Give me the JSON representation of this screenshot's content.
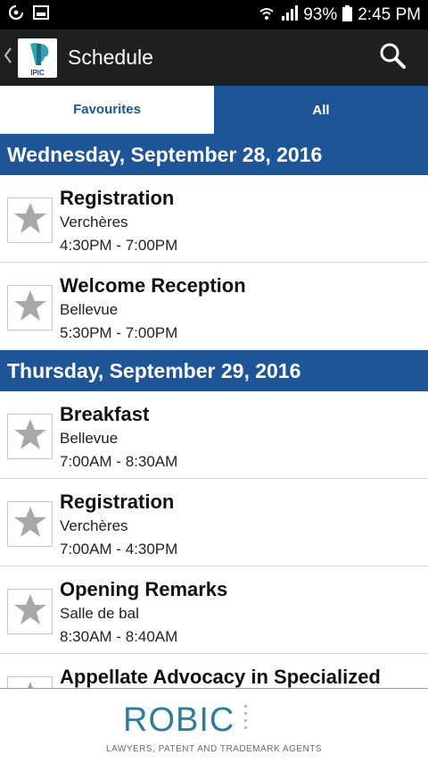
{
  "status_bar": {
    "battery": "93%",
    "time": "2:45 PM"
  },
  "app_bar": {
    "title": "Schedule",
    "logo_text": "IPIC"
  },
  "tabs": [
    {
      "label": "Favourites",
      "active": false
    },
    {
      "label": "All",
      "active": true
    }
  ],
  "days": [
    {
      "date": "Wednesday, September 28, 2016",
      "events": [
        {
          "title": "Registration",
          "room": "Verchères",
          "time": "4:30PM - 7:00PM"
        },
        {
          "title": "Welcome Reception",
          "room": "Bellevue",
          "time": "5:30PM - 7:00PM"
        }
      ]
    },
    {
      "date": "Thursday, September 29, 2016",
      "events": [
        {
          "title": "Breakfast",
          "room": "Bellevue",
          "time": "7:00AM - 8:30AM"
        },
        {
          "title": "Registration",
          "room": "Verchères",
          "time": "7:00AM - 4:30PM"
        },
        {
          "title": "Opening Remarks",
          "room": "Salle de bal",
          "time": "8:30AM - 8:40AM"
        },
        {
          "title": "Appellate Advocacy in Specialized",
          "room": "",
          "time": ""
        }
      ]
    }
  ],
  "footer": {
    "brand": "ROBIC",
    "tagline": "LAWYERS, PATENT AND TRADEMARK AGENTS"
  },
  "colors": {
    "primary": "#1e5596",
    "star": "#a8a8a8",
    "brand": "#2c7d99"
  },
  "icons": {
    "favourite": "star-icon",
    "search": "search-icon",
    "back": "chevron-left-icon"
  }
}
